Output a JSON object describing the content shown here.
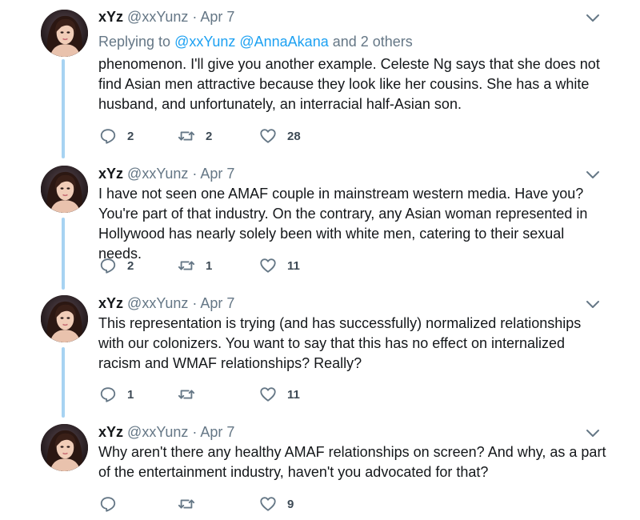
{
  "colors": {
    "background": "#ffffff",
    "thread_line": "#a7d3f2",
    "mention": "#1da1f2",
    "secondary_text": "#657786",
    "icon": "#657786"
  },
  "icons": {
    "reply": "reply-icon",
    "retweet": "retweet-icon",
    "like": "heart-icon",
    "menu": "chevron-down-icon"
  },
  "tweets": [
    {
      "name": "xYz",
      "handle": "@xxYunz",
      "separator": "·",
      "date": "Apr 7",
      "replying_prefix": "Replying to ",
      "replying_mentions": "@xxYunz @AnnaAkana",
      "replying_suffix": " and 2 others",
      "text": "phenomenon. I'll give you another example. Celeste Ng says that she does not find Asian men attractive because they look like her cousins. She has a white husband, and unfortunately, an interracial half-Asian son.",
      "replies": "2",
      "retweets": "2",
      "likes": "28"
    },
    {
      "name": "xYz",
      "handle": "@xxYunz",
      "separator": "·",
      "date": "Apr 7",
      "text": "I have not seen one AMAF couple in mainstream western media. Have you? You're part of that industry. On the contrary, any Asian woman represented in Hollywood has nearly solely been with white men, catering to their sexual needs.",
      "replies": "2",
      "retweets": "1",
      "likes": "11"
    },
    {
      "name": "xYz",
      "handle": "@xxYunz",
      "separator": "·",
      "date": "Apr 7",
      "text": "This representation is trying (and has successfully) normalized relationships with our colonizers. You want to say that this has no effect on internalized racism and WMAF relationships? Really?",
      "replies": "1",
      "retweets": "",
      "likes": "11"
    },
    {
      "name": "xYz",
      "handle": "@xxYunz",
      "separator": "·",
      "date": "Apr 7",
      "text": "Why aren't there any healthy AMAF relationships on screen? And why, as a part of the entertainment industry, haven't you advocated for that?",
      "replies": "",
      "retweets": "",
      "likes": "9"
    }
  ]
}
